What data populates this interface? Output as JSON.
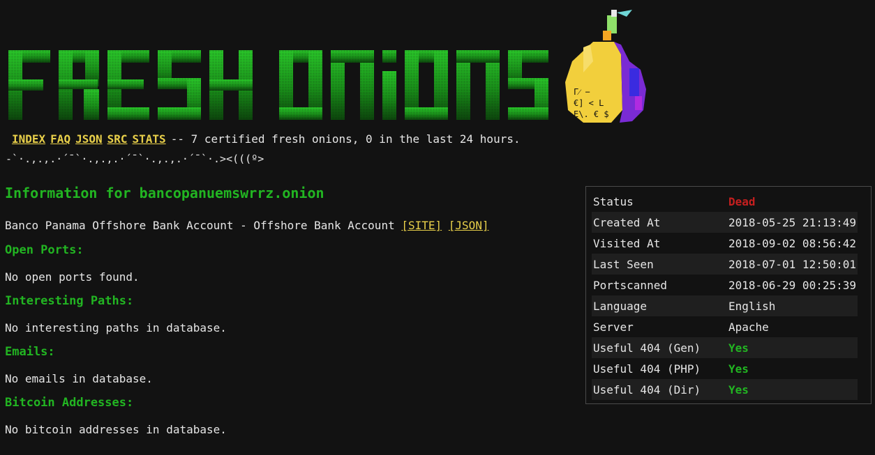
{
  "banner": {
    "text": "FRESH ONIONS"
  },
  "nav": {
    "links": [
      "INDEX",
      "FAQ",
      "JSON",
      "SRC",
      "STATS"
    ],
    "summary": "-- 7 certified fresh onions, 0 in the last 24 hours."
  },
  "fish": "-`·.,.,.·´¯`·.,.,.·´¯`·.,.,.·´¯`·.><(((º>",
  "main": {
    "title": "Information for bancopanuemswrrz.onion",
    "description": "Banco Panama Offshore Bank Account - Offshore Bank Account",
    "site_link": "[SITE]",
    "json_link": "[JSON]",
    "sections": [
      {
        "heading": "Open Ports:",
        "text": "No open ports found."
      },
      {
        "heading": "Interesting Paths:",
        "text": "No interesting paths in database."
      },
      {
        "heading": "Emails:",
        "text": "No emails in database."
      },
      {
        "heading": "Bitcoin Addresses:",
        "text": "No bitcoin addresses in database."
      }
    ]
  },
  "info": {
    "rows": [
      {
        "label": "Status",
        "value": "Dead",
        "kind": "dead"
      },
      {
        "label": "Created At",
        "value": "2018-05-25 21:13:49",
        "kind": "plain"
      },
      {
        "label": "Visited At",
        "value": "2018-09-02 08:56:42",
        "kind": "plain"
      },
      {
        "label": "Last Seen",
        "value": "2018-07-01 12:50:01",
        "kind": "plain"
      },
      {
        "label": "Portscanned",
        "value": "2018-06-29 00:25:39",
        "kind": "plain"
      },
      {
        "label": "Language",
        "value": "English",
        "kind": "plain"
      },
      {
        "label": "Server",
        "value": "Apache",
        "kind": "plain"
      },
      {
        "label": "Useful 404 (Gen)",
        "value": "Yes",
        "kind": "yes"
      },
      {
        "label": "Useful 404 (PHP)",
        "value": "Yes",
        "kind": "yes"
      },
      {
        "label": "Useful 404 (Dir)",
        "value": "Yes",
        "kind": "yes"
      }
    ]
  },
  "colors": {
    "background": "#121212",
    "heading_green": "#22b522",
    "link_yellow": "#e9d04a",
    "dead_red": "#c51f1f"
  }
}
